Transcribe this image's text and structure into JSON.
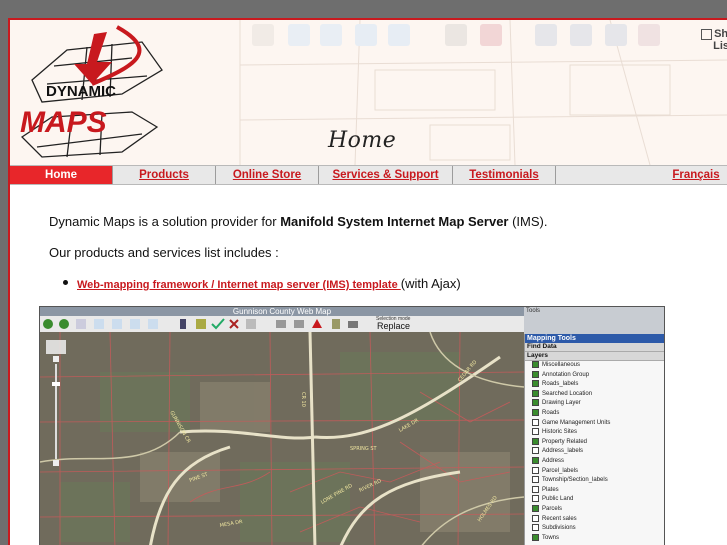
{
  "banner": {
    "logo_top": "DYNAMIC",
    "logo_bottom": "MAPS",
    "heading": "Home",
    "side_text_1": "Sh",
    "side_text_2": "Lis"
  },
  "nav": {
    "items": [
      {
        "label": "Home"
      },
      {
        "label": "Products"
      },
      {
        "label": "Online Store"
      },
      {
        "label": "Services & Support"
      },
      {
        "label": "Testimonials"
      }
    ],
    "language_link": "Français"
  },
  "content": {
    "intro_prefix": "Dynamic Maps is a solution provider for ",
    "intro_bold": "Manifold System Internet Map Server",
    "intro_suffix": " (IMS).",
    "products_intro": "Our products and services list includes :",
    "list_link": "Web-mapping framework / Internet map server (IMS) template ",
    "list_suffix": "(with Ajax)"
  },
  "screenshot": {
    "title": "Gunnison County Web Map",
    "corner_label": "Tools",
    "selection_mode_label": "Selection mode",
    "selection_mode_value": "Replace",
    "panel_title": "Mapping Tools",
    "find_data": "Find Data",
    "layers_title": "Layers",
    "layers": [
      {
        "name": "Miscellaneous",
        "on": true
      },
      {
        "name": "Annotation Group",
        "on": true
      },
      {
        "name": "Roads_labels",
        "on": true
      },
      {
        "name": "Searched Location",
        "on": true
      },
      {
        "name": "Drawing Layer",
        "on": true
      },
      {
        "name": "Roads",
        "on": true
      },
      {
        "name": "Game Management Units",
        "on": false
      },
      {
        "name": "Historic Sites",
        "on": false
      },
      {
        "name": "Property Related",
        "on": true
      },
      {
        "name": "Address_labels",
        "on": false
      },
      {
        "name": "Address",
        "on": true
      },
      {
        "name": "Parcel_labels",
        "on": false
      },
      {
        "name": "Township/Section_labels",
        "on": false
      },
      {
        "name": "Plates",
        "on": false
      },
      {
        "name": "Public Land",
        "on": false
      },
      {
        "name": "Parcels",
        "on": true
      },
      {
        "name": "Recent sales",
        "on": false
      },
      {
        "name": "Subdivisions",
        "on": false
      },
      {
        "name": "Towns",
        "on": true
      }
    ],
    "road_labels": [
      "GUNNISON CR",
      "CR 10",
      "CEDAR RD",
      "SPRING ST",
      "LAKE DR",
      "PINE ST",
      "RIVER RD",
      "LONE PINE RD",
      "HOLMES RD",
      "MESA DR"
    ]
  },
  "colors": {
    "accent_red": "#c8191e",
    "nav_active": "#e8262a",
    "panel_blue": "#2d5aa9"
  }
}
